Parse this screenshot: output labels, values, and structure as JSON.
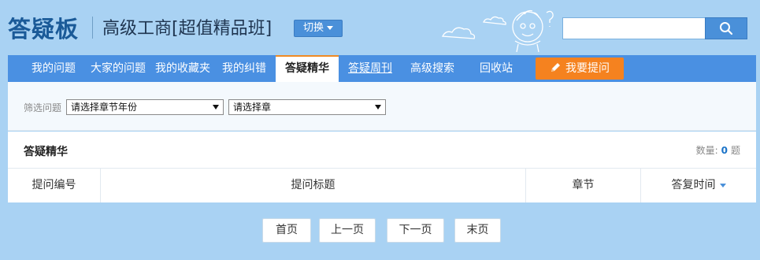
{
  "header": {
    "logo": "答疑板",
    "course_title": "高级工商[超值精品班]",
    "switch_label": "切换",
    "search": {
      "value": "",
      "placeholder": ""
    },
    "search_icon": "search-icon"
  },
  "nav": {
    "items": [
      {
        "label": "我的问题"
      },
      {
        "label": "大家的问题"
      },
      {
        "label": "我的收藏夹"
      },
      {
        "label": "我的纠错"
      },
      {
        "label": "答疑精华",
        "active": true
      },
      {
        "label": "答疑周刊",
        "underline": true
      },
      {
        "label": "高级搜索"
      },
      {
        "label": "回收站"
      }
    ],
    "ask_button": {
      "label": "我要提问",
      "icon": "pencil-icon"
    }
  },
  "filter": {
    "label": "筛选问题",
    "year_select": {
      "selected": "请选择章节年份"
    },
    "chapter_select": {
      "selected": "请选择章"
    }
  },
  "section": {
    "title": "答疑精华",
    "count_label": "数量:",
    "count_value": "0",
    "count_unit": "题"
  },
  "table": {
    "columns": [
      {
        "label": "提问编号"
      },
      {
        "label": "提问标题"
      },
      {
        "label": "章节"
      },
      {
        "label": "答复时间",
        "sortable": true
      }
    ],
    "rows": []
  },
  "pager": {
    "first": "首页",
    "prev": "上一页",
    "next": "下一页",
    "last": "末页"
  },
  "colors": {
    "header_bg": "#a9d2f3",
    "nav_bg": "#4a90e2",
    "accent_orange": "#f5821f",
    "logo_blue": "#1a5a98",
    "count_blue": "#1a73c8"
  }
}
